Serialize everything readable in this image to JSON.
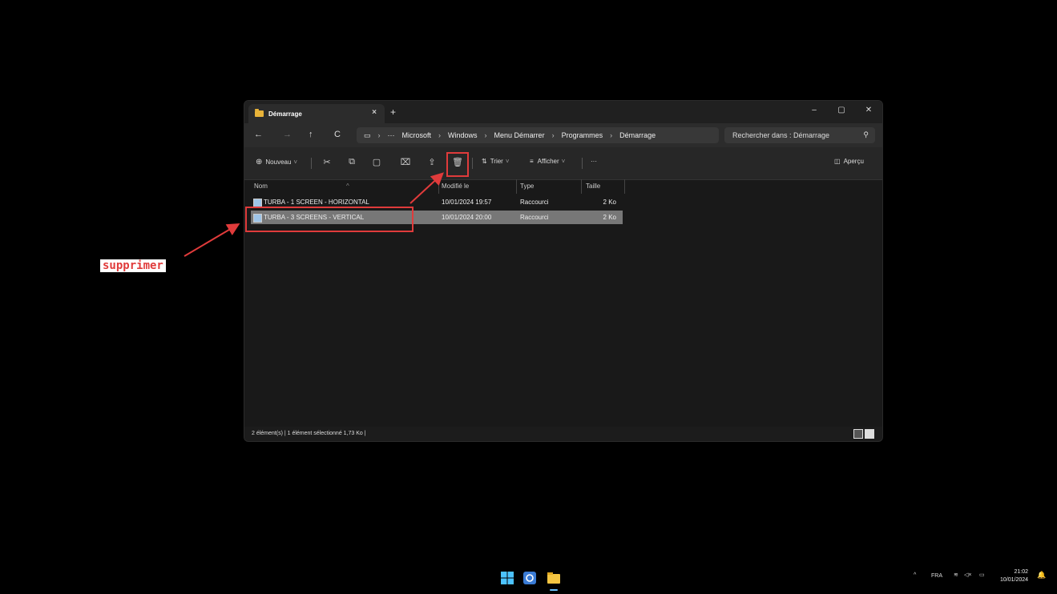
{
  "window": {
    "tab_title": "Démarrage",
    "tab_close": "×",
    "new_tab": "+",
    "controls": {
      "minimize": "–",
      "maximize": "▢",
      "close": "✕"
    }
  },
  "nav": {
    "back": "←",
    "forward": "→",
    "up": "↑",
    "refresh": "C",
    "overflow": "···",
    "breadcrumb": [
      "Microsoft",
      "Windows",
      "Menu Démarrer",
      "Programmes",
      "Démarrage"
    ],
    "search_placeholder": "Rechercher dans : Démarrage"
  },
  "toolbar": {
    "new_label": "Nouveau",
    "sort_label": "Trier",
    "view_label": "Afficher",
    "more_label": "···",
    "preview_label": "Aperçu"
  },
  "columns": {
    "name": "Nom",
    "modified": "Modifié le",
    "type": "Type",
    "size": "Taille"
  },
  "files": [
    {
      "name": "TURBA - 1 SCREEN - HORIZONTAL",
      "modified": "10/01/2024 19:57",
      "type": "Raccourci",
      "size": "2 Ko",
      "selected": false
    },
    {
      "name": "TURBA - 3 SCREENS - VERTICAL",
      "modified": "10/01/2024 20:00",
      "type": "Raccourci",
      "size": "2 Ko",
      "selected": true
    }
  ],
  "status": {
    "text": "2 élément(s)  |  1 élément sélectionné 1,73 Ko  |"
  },
  "annotation": {
    "label": "supprimer",
    "color": "#e03b3b"
  },
  "taskbar": {
    "language": "FRA",
    "time": "21:02",
    "date": "10/01/2024",
    "tray_chevron": "^"
  }
}
